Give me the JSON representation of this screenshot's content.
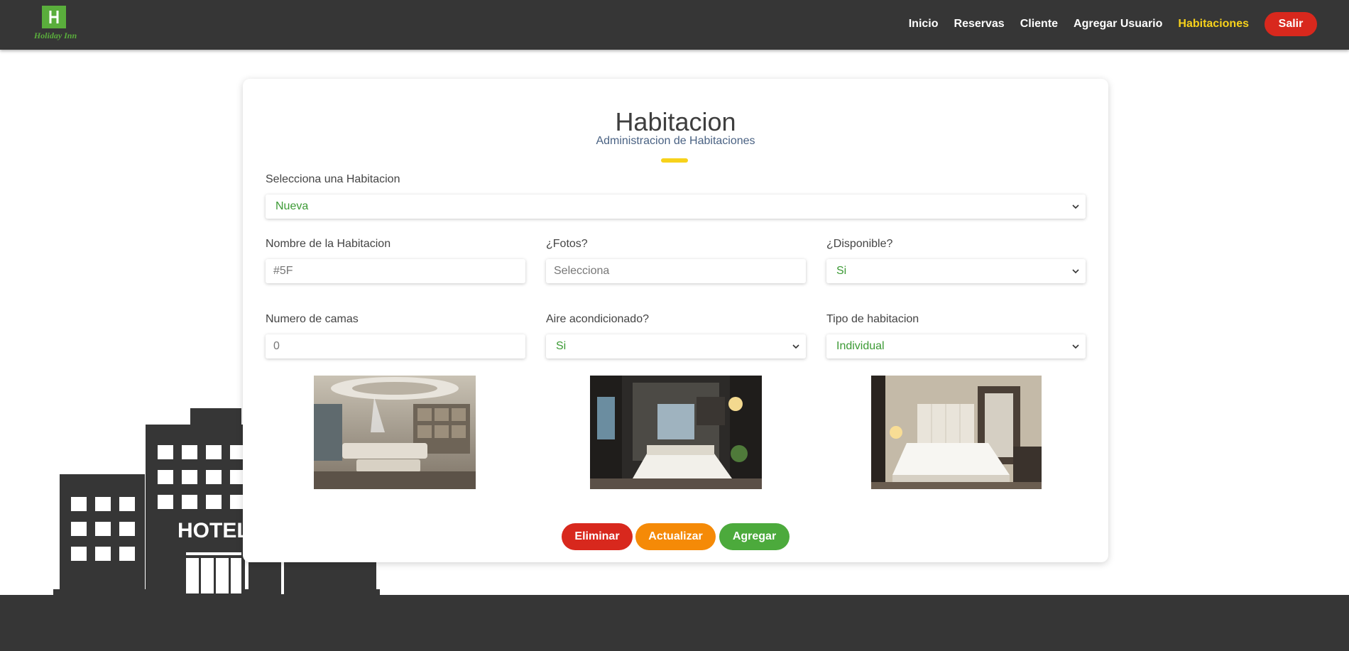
{
  "brand": {
    "logo_text": "Holiday Inn",
    "logo_mark": "H"
  },
  "nav": {
    "items": [
      {
        "label": "Inicio",
        "active": false
      },
      {
        "label": "Reservas",
        "active": false
      },
      {
        "label": "Cliente",
        "active": false
      },
      {
        "label": "Agregar Usuario",
        "active": false
      },
      {
        "label": "Habitaciones",
        "active": true
      }
    ],
    "logout_label": "Salir"
  },
  "background": {
    "hotel_sign": "HOTEL"
  },
  "card": {
    "title": "Habitacion",
    "subtitle": "Administracion de Habitaciones"
  },
  "form": {
    "room_select": {
      "label": "Selecciona una Habitacion",
      "value": "Nueva"
    },
    "room_name": {
      "label": "Nombre de la Habitacion",
      "placeholder": "#5F"
    },
    "photos": {
      "label": "¿Fotos?",
      "placeholder": "Selecciona"
    },
    "available": {
      "label": "¿Disponible?",
      "value": "Si"
    },
    "beds": {
      "label": "Numero de camas",
      "placeholder": "0"
    },
    "air": {
      "label": "Aire acondicionado?",
      "value": "Si"
    },
    "room_type": {
      "label": "Tipo de habitacion",
      "value": "Individual"
    }
  },
  "buttons": {
    "delete": "Eliminar",
    "update": "Actualizar",
    "add": "Agregar"
  },
  "colors": {
    "navbar": "#363636",
    "accent_yellow": "#f7d21b",
    "danger": "#d8281d",
    "warning": "#f58a07",
    "success": "#4caa3c",
    "select_text": "#3c9a35"
  }
}
